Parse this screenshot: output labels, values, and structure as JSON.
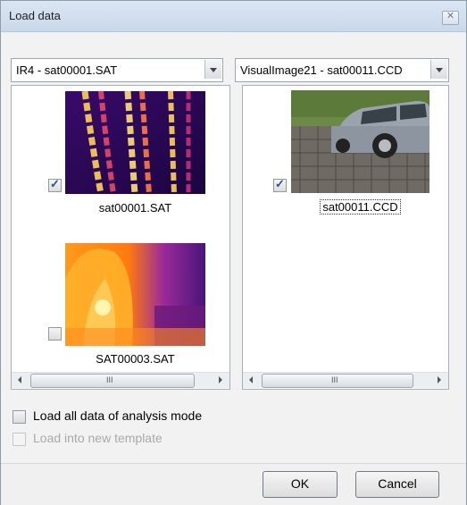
{
  "window": {
    "title": "Load data"
  },
  "left_pane": {
    "dropdown_value": "IR4 - sat00001.SAT",
    "items": [
      {
        "label": "sat00001.SAT",
        "checked": true
      },
      {
        "label": "SAT00003.SAT",
        "checked": false
      }
    ],
    "scroll_grip": "III"
  },
  "right_pane": {
    "dropdown_value": "VisualImage21 - sat00011.CCD",
    "items": [
      {
        "label": "sat00011.CCD",
        "checked": true
      }
    ],
    "scroll_grip": "III"
  },
  "options": {
    "load_all": {
      "label": "Load all data of analysis mode",
      "checked": false
    },
    "new_template": {
      "label": "Load into new template",
      "checked": false,
      "enabled": false
    }
  },
  "buttons": {
    "ok": "OK",
    "cancel": "Cancel"
  },
  "icons": [
    "close-icon",
    "dropdown-arrow-icon",
    "scroll-left-icon",
    "scroll-right-icon"
  ]
}
